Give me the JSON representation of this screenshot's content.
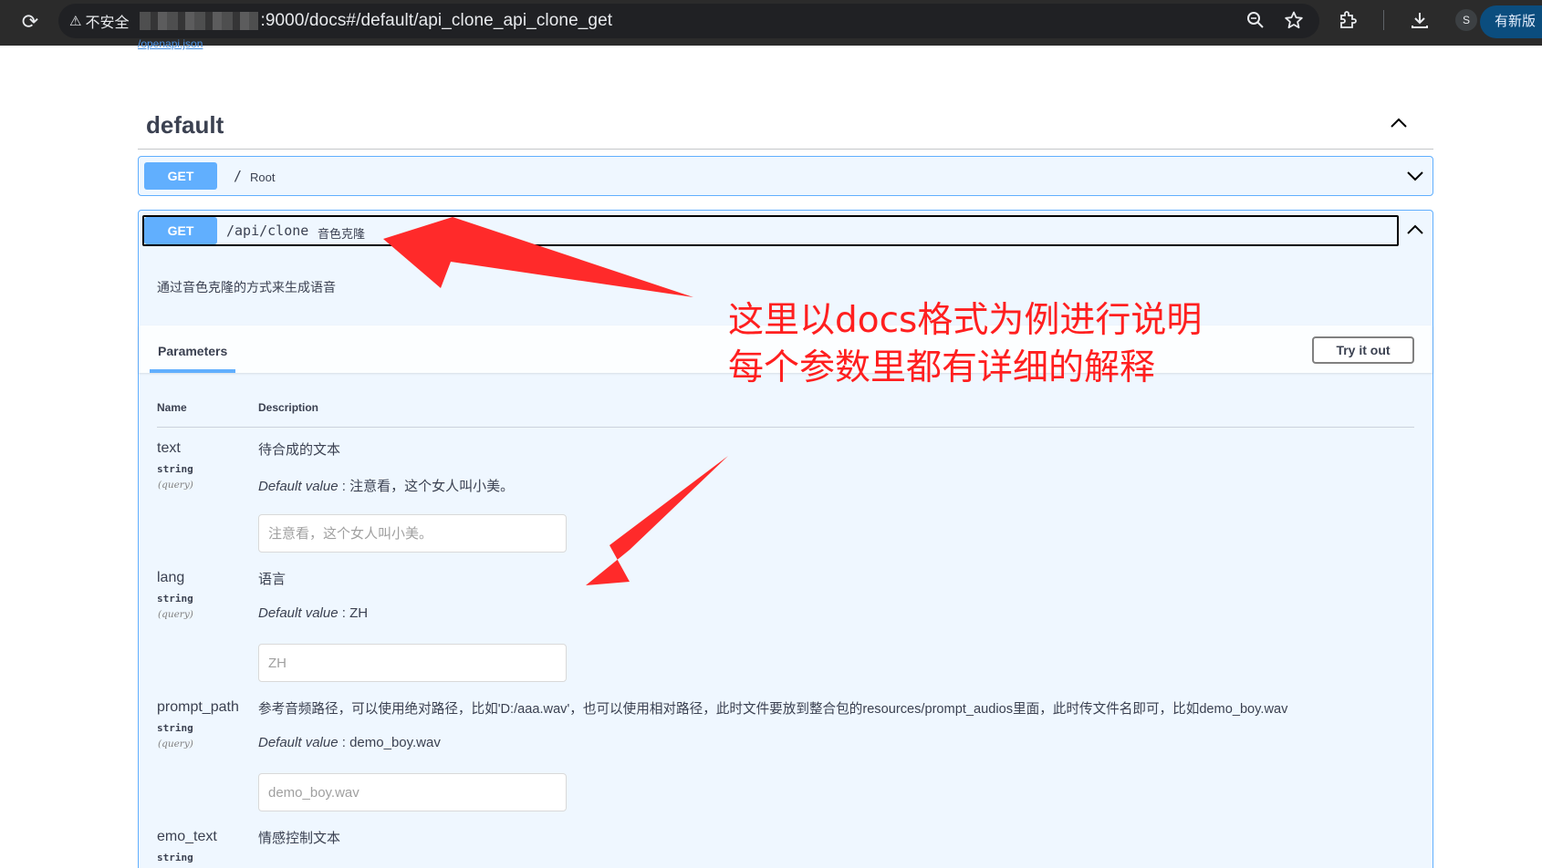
{
  "browser": {
    "security_label": "不安全",
    "url": ":9000/docs#/default/api_clone_api_clone_get",
    "avatar_letter": "S",
    "update_label": "有新版"
  },
  "openapi_link": "/openapi.json",
  "section": {
    "title": "default"
  },
  "operations": {
    "root": {
      "method": "GET",
      "path": "/",
      "summary": "Root"
    },
    "clone": {
      "method": "GET",
      "path": "/api/clone",
      "summary": "音色克隆",
      "description": "通过音色克隆的方式来生成语音"
    }
  },
  "parameters_tab": "Parameters",
  "try_button": "Try it out",
  "table_headers": {
    "name": "Name",
    "description": "Description"
  },
  "default_label": "Default value",
  "params": [
    {
      "name": "text",
      "type": "string",
      "in": "(query)",
      "description": "待合成的文本",
      "default": "注意看，这个女人叫小美。",
      "placeholder": "注意看，这个女人叫小美。"
    },
    {
      "name": "lang",
      "type": "string",
      "in": "(query)",
      "description": "语言",
      "default": "ZH",
      "placeholder": "ZH"
    },
    {
      "name": "prompt_path",
      "type": "string",
      "in": "(query)",
      "description": "参考音频路径，可以使用绝对路径，比如'D:/aaa.wav'，也可以使用相对路径，此时文件要放到整合包的resources/prompt_audios里面，此时传文件名即可，比如demo_boy.wav",
      "default": "demo_boy.wav",
      "placeholder": "demo_boy.wav"
    },
    {
      "name": "emo_text",
      "type": "string",
      "in": "(query)",
      "description": "情感控制文本"
    }
  ],
  "annotation": {
    "line1": "这里以docs格式为例进行说明",
    "line2": "每个参数里都有详细的解释"
  },
  "colors": {
    "get": "#61affe",
    "annotation": "#ff1f1f"
  }
}
